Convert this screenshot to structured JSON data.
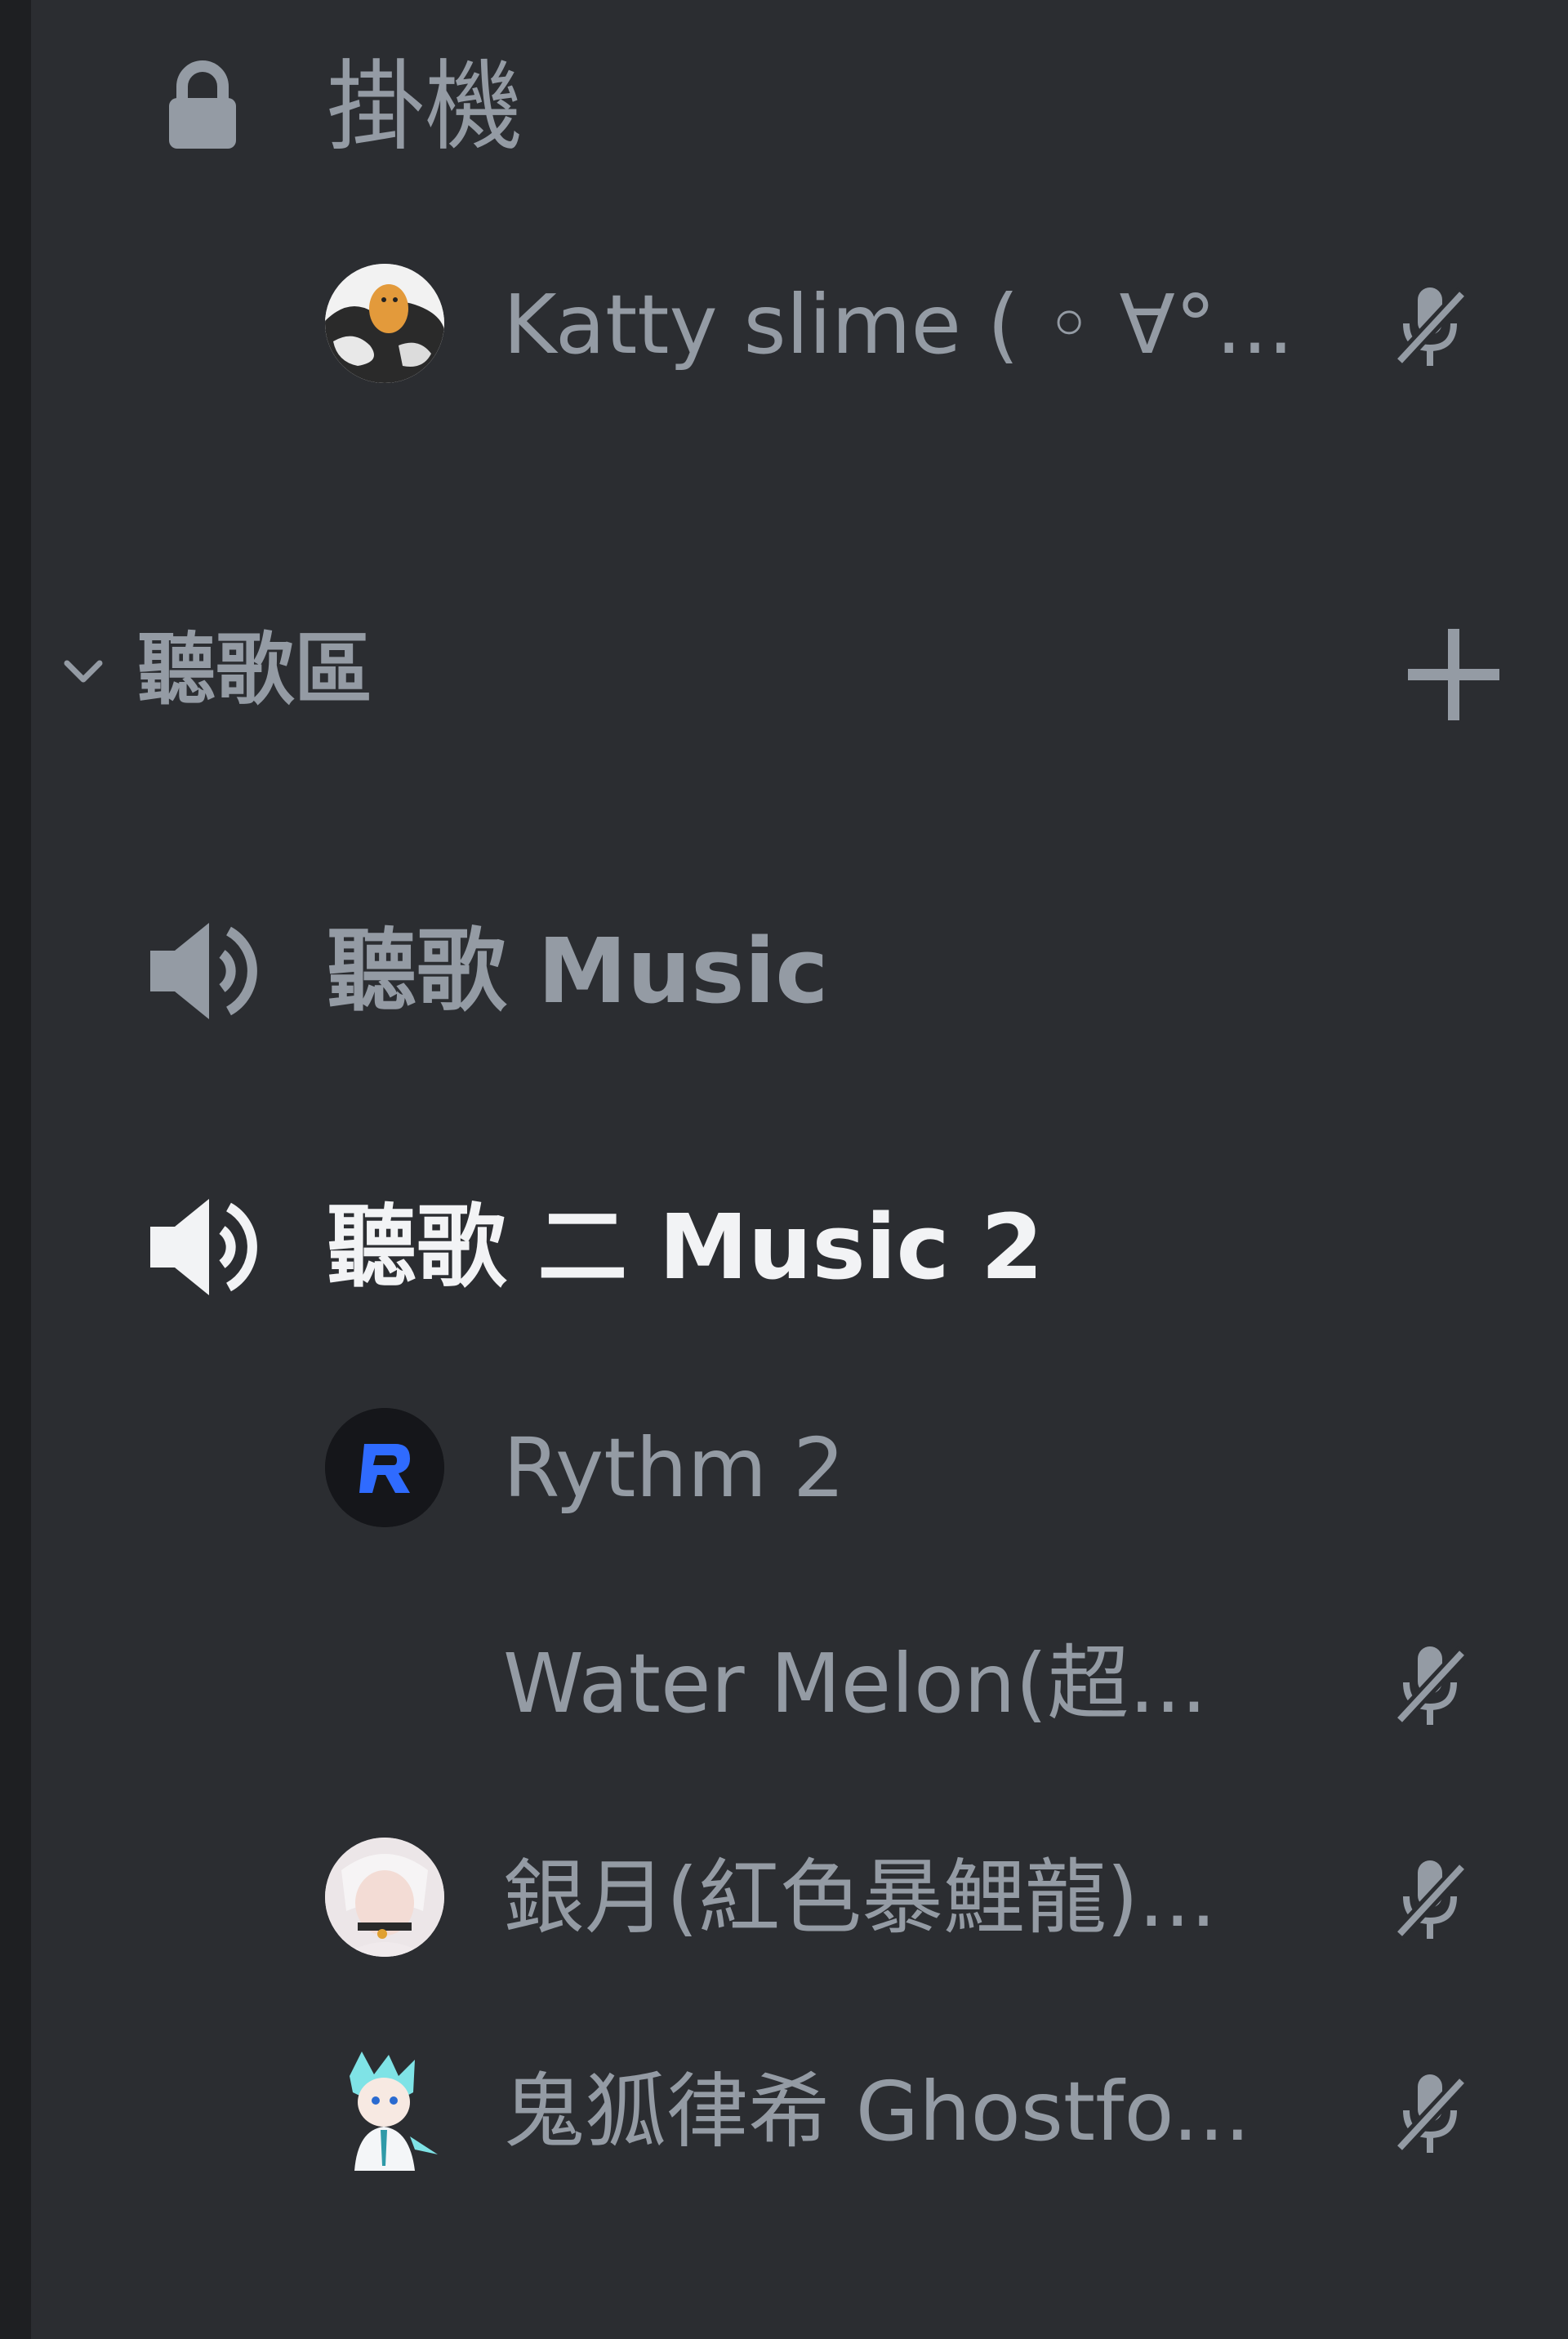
{
  "colors": {
    "text_muted": "#949ba4",
    "text_active": "#f2f3f5",
    "panel_bg": "#2b2d31",
    "rythm_blue": "#2f6bff"
  },
  "channels": {
    "afk": {
      "name": "掛機",
      "icon": "lock-icon"
    },
    "category": {
      "name": "聽歌區",
      "collapse_icon": "chevron-down-icon",
      "add_icon": "plus-icon"
    },
    "music1": {
      "name": "聽歌 Music",
      "icon": "speaker-icon"
    },
    "music2": {
      "name": "聽歌 二 Music 2",
      "icon": "speaker-icon"
    }
  },
  "members": {
    "katty": {
      "name": "Katty slime ( ◦ ∀°...",
      "muted_icon": "mic-muted-icon"
    },
    "rythm": {
      "name": "Rythm 2",
      "avatar_letter": "R"
    },
    "watermelon": {
      "name": "Water Melon(超...",
      "muted_icon": "mic-muted-icon"
    },
    "yinyue": {
      "name": "銀月(紅色暴鯉龍)...",
      "muted_icon": "mic-muted-icon"
    },
    "ghostfox": {
      "name": "鬼狐律希 Ghostfo...",
      "muted_icon": "mic-muted-icon"
    }
  }
}
